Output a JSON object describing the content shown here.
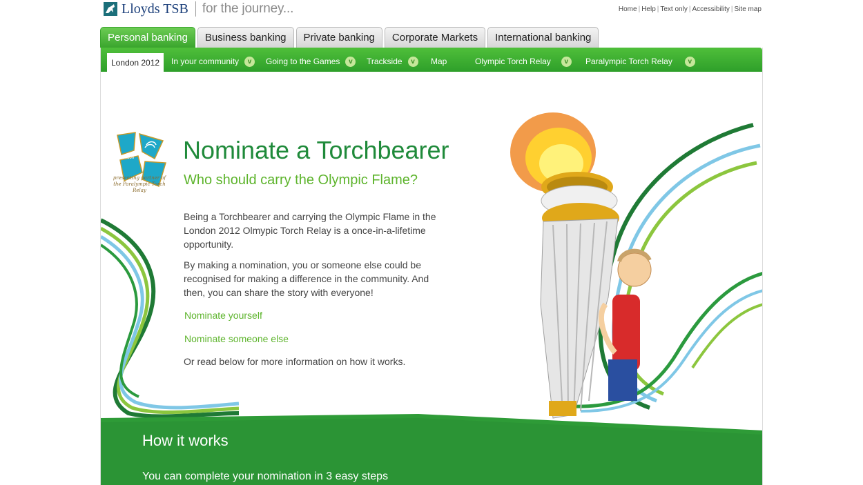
{
  "header": {
    "brand_name": "Lloyds TSB",
    "tagline": "for the journey...",
    "utility_links": [
      "Home",
      "Help",
      "Text only",
      "Accessibility",
      "Site map"
    ]
  },
  "primary_tabs": [
    {
      "label": "Personal banking",
      "active": true
    },
    {
      "label": "Business banking",
      "active": false
    },
    {
      "label": "Private banking",
      "active": false
    },
    {
      "label": "Corporate Markets",
      "active": false
    },
    {
      "label": "International banking",
      "active": false
    }
  ],
  "sub_nav": [
    {
      "label": "London 2012",
      "active": true,
      "dropdown": false
    },
    {
      "label": "In your community",
      "active": false,
      "dropdown": true
    },
    {
      "label": "Going to the Games",
      "active": false,
      "dropdown": true
    },
    {
      "label": "Trackside",
      "active": false,
      "dropdown": true
    },
    {
      "label": "Map",
      "active": false,
      "dropdown": false
    },
    {
      "label": "Olympic Torch Relay",
      "active": false,
      "dropdown": true
    },
    {
      "label": "Paralympic Torch Relay",
      "active": false,
      "dropdown": true
    }
  ],
  "emblem": {
    "logo_text": "london",
    "caption": "presenting partner of the Paralympic Torch Relay"
  },
  "content": {
    "title": "Nominate a Torchbearer",
    "subtitle": "Who should carry the Olympic Flame?",
    "paragraph_1": "Being a Torchbearer and carrying the Olympic Flame in the London 2012 Olmypic Torch Relay is a once-in-a-lifetime opportunity.",
    "paragraph_2": "By making a nomination, you or someone else could be recognised for making a difference in the community. And then, you can share the story with everyone!",
    "link_1": "Nominate yourself",
    "link_2": "Nominate someone else",
    "paragraph_3": "Or read below for more information on how it works."
  },
  "how_it_works": {
    "title": "How it works",
    "intro": "You can complete your nomination in 3 easy steps"
  },
  "colors": {
    "brand_green": "#3aa52d",
    "headline_green": "#1f8a3a",
    "link_green": "#5db42c",
    "brand_blue": "#1b3f7a"
  }
}
